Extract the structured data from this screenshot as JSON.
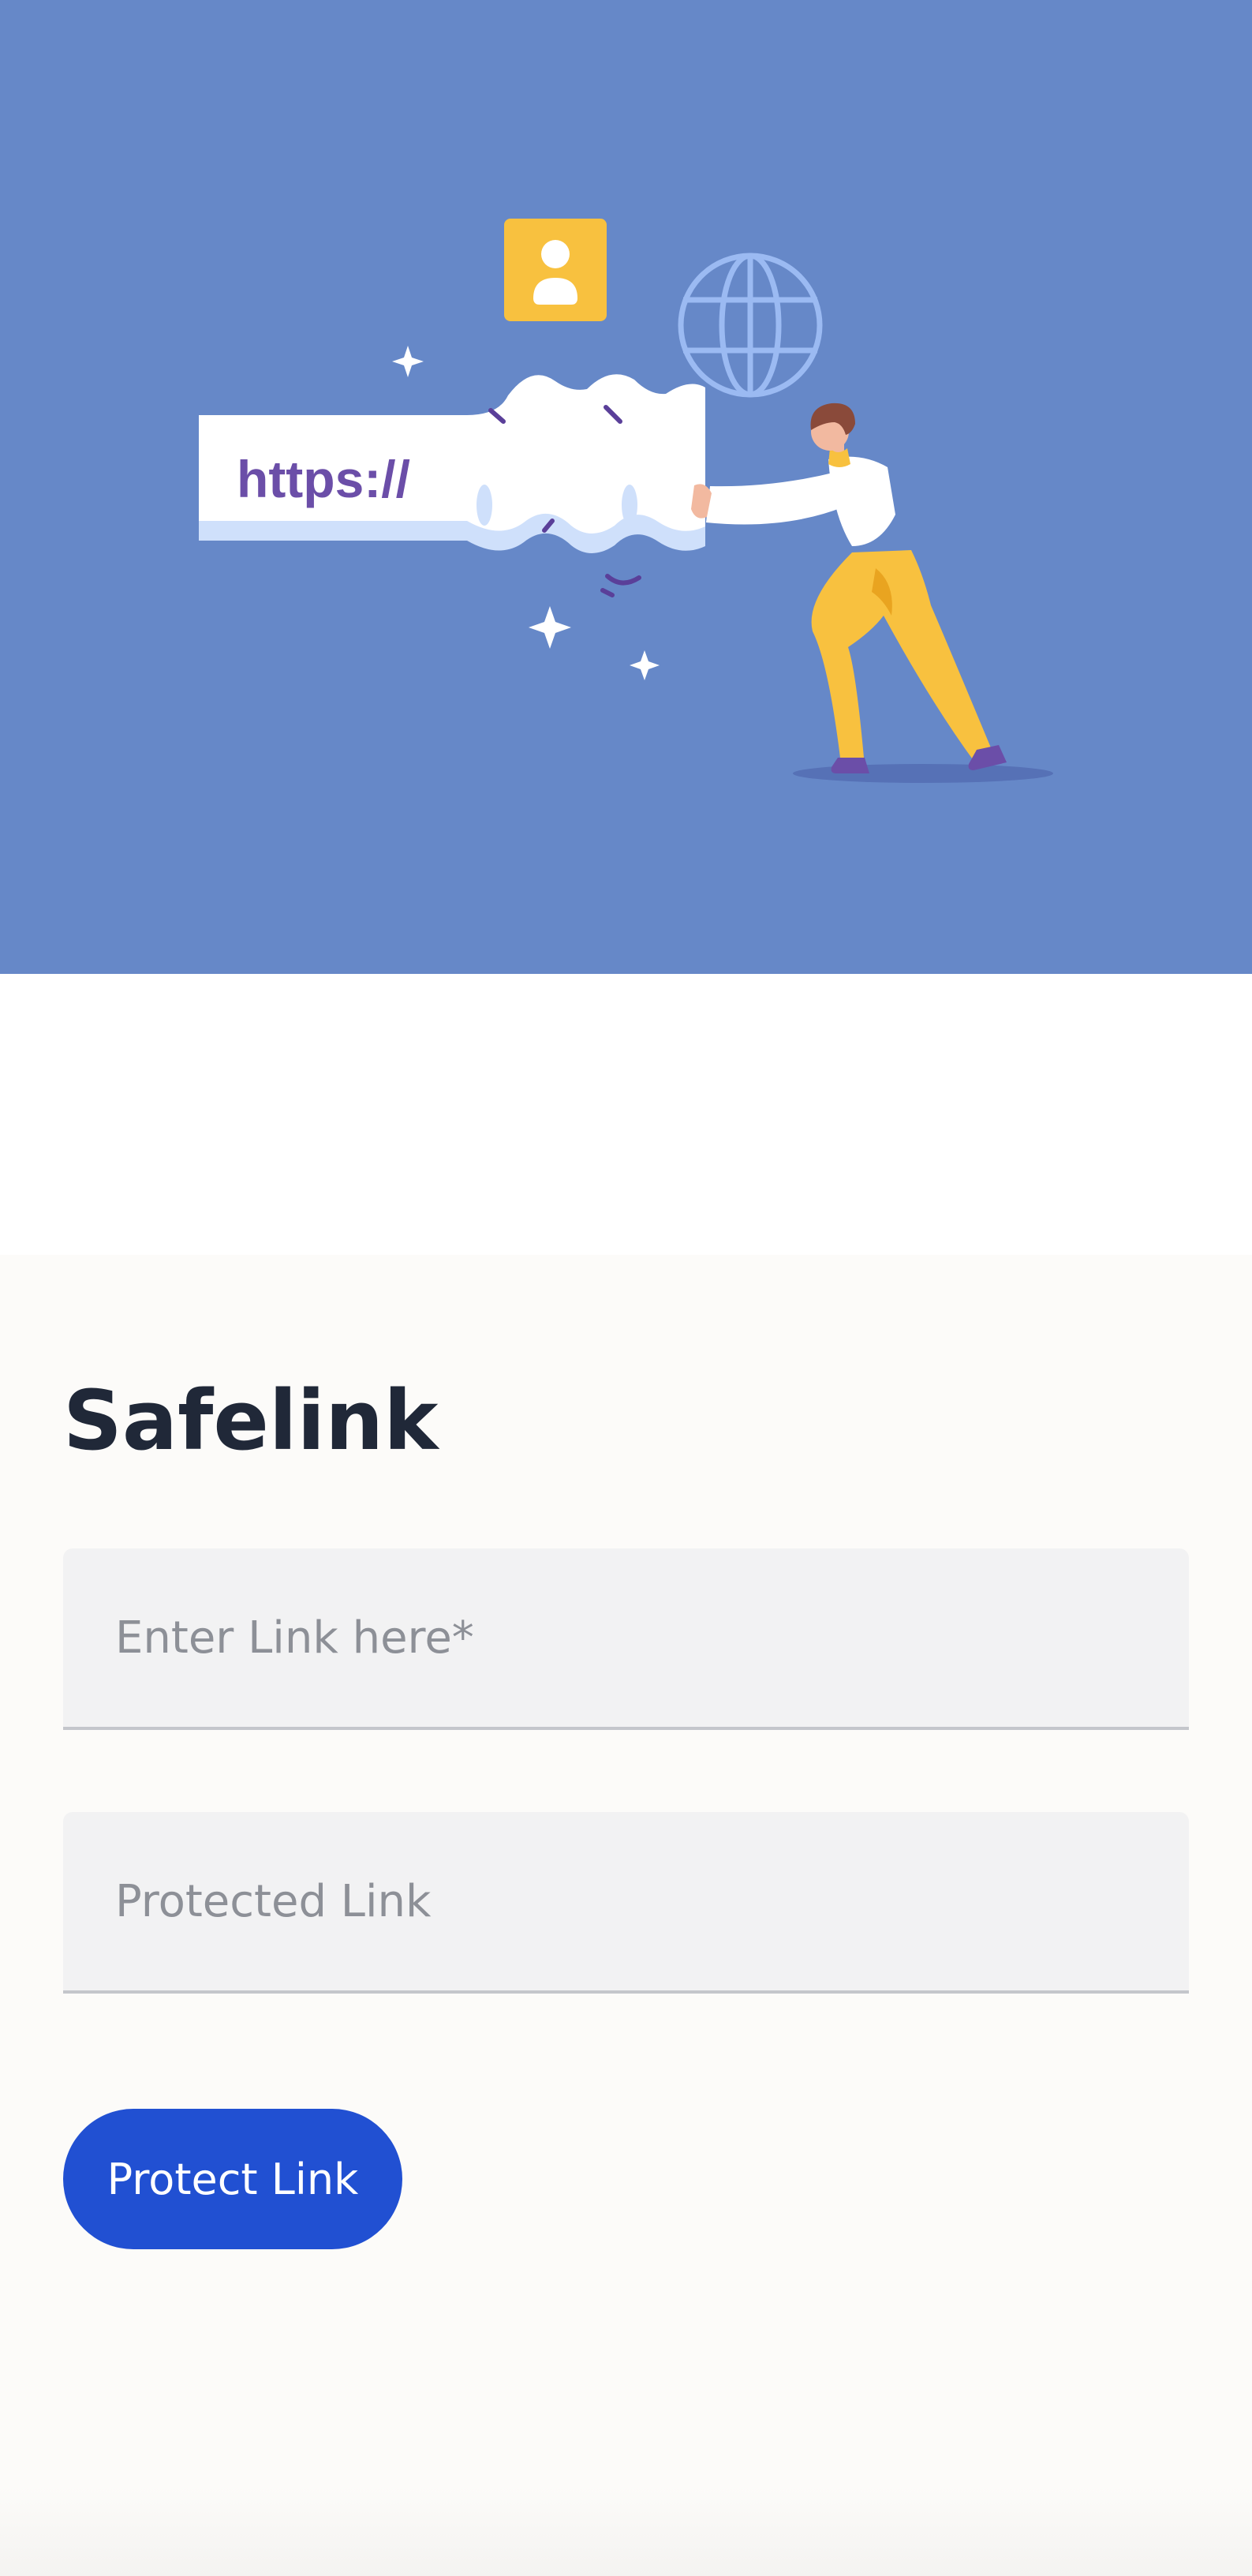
{
  "hero": {
    "url_text": "https://",
    "colors": {
      "background": "#6688c8",
      "accent_yellow": "#f8c13f",
      "brand_purple": "#6b4ea8"
    },
    "icons": [
      "user-badge-icon",
      "globe-icon",
      "sparkle-icon",
      "person-pushing-illustration"
    ]
  },
  "form": {
    "title": "Safelink",
    "link_input": {
      "placeholder": "Enter Link here*",
      "value": ""
    },
    "protected_input": {
      "placeholder": "Protected Link",
      "value": ""
    },
    "submit_label": "Protect Link"
  },
  "colors": {
    "button": "#2150d2",
    "title": "#202838"
  }
}
